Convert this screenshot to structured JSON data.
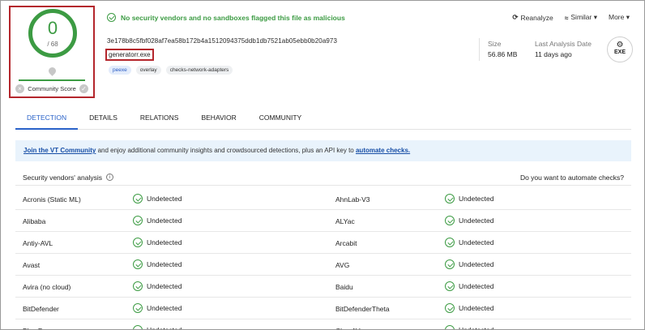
{
  "score": {
    "detections": "0",
    "total": "/ 68",
    "community_label": "Community Score",
    "minus": "×",
    "plus": "✓"
  },
  "banner": {
    "message": "No security vendors and no sandboxes flagged this file as malicious"
  },
  "actions": [
    {
      "icon": "reanalyze-icon",
      "glyph": "⟳",
      "label": "Reanalyze"
    },
    {
      "icon": "similar-icon",
      "glyph": "≈",
      "label": "Similar ▾"
    },
    {
      "icon": "more-icon",
      "glyph": "",
      "label": "More ▾"
    }
  ],
  "file": {
    "hash": "3e178b8c5fbf028af7ea58b172b4a1512094375ddb1db7521ab05ebb0b20a973",
    "name": "generatorr.exe",
    "tags": [
      "peexe",
      "overlay",
      "checks-network-adapters"
    ],
    "size_label": "Size",
    "size_value": "56.86 MB",
    "date_label": "Last Analysis Date",
    "date_value": "11 days ago",
    "type": "EXE"
  },
  "tabs": [
    "DETECTION",
    "DETAILS",
    "RELATIONS",
    "BEHAVIOR",
    "COMMUNITY"
  ],
  "notice": {
    "link1": "Join the VT Community",
    "text": " and enjoy additional community insights and crowdsourced detections, plus an API key to ",
    "link2": "automate checks."
  },
  "vendors_header": {
    "title": "Security vendors' analysis",
    "info": "i",
    "right": "Do you want to automate checks?"
  },
  "vendors": [
    {
      "left": "Acronis (Static ML)",
      "left_result": "Undetected",
      "right": "AhnLab-V3",
      "right_result": "Undetected"
    },
    {
      "left": "Alibaba",
      "left_result": "Undetected",
      "right": "ALYac",
      "right_result": "Undetected"
    },
    {
      "left": "Antiy-AVL",
      "left_result": "Undetected",
      "right": "Arcabit",
      "right_result": "Undetected"
    },
    {
      "left": "Avast",
      "left_result": "Undetected",
      "right": "AVG",
      "right_result": "Undetected"
    },
    {
      "left": "Avira (no cloud)",
      "left_result": "Undetected",
      "right": "Baidu",
      "right_result": "Undetected"
    },
    {
      "left": "BitDefender",
      "left_result": "Undetected",
      "right": "BitDefenderTheta",
      "right_result": "Undetected"
    },
    {
      "left": "BkavPro",
      "left_result": "Undetected",
      "right": "ClamAV",
      "right_result": "Undetected"
    }
  ],
  "colors": {
    "clean": "#3c9b43",
    "highlight": "#b4262c",
    "link": "#2a62c9"
  }
}
